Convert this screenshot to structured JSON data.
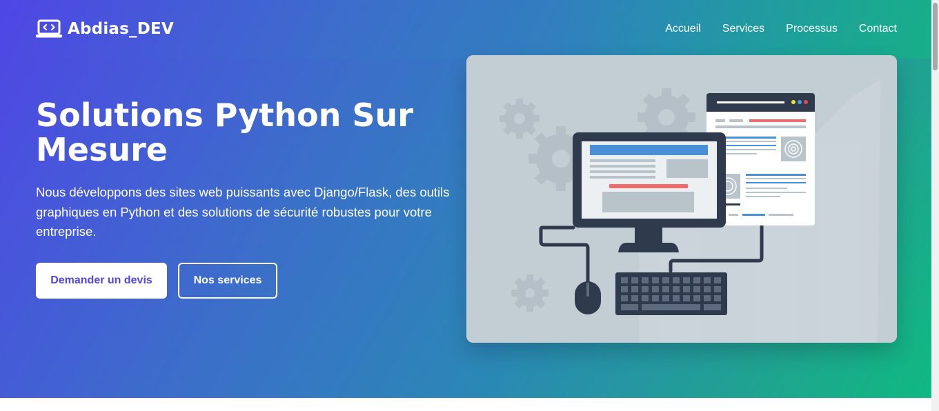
{
  "brand": {
    "name": "Abdias_DEV",
    "icon": "laptop-code-icon"
  },
  "nav": {
    "items": [
      {
        "label": "Accueil"
      },
      {
        "label": "Services"
      },
      {
        "label": "Processus"
      },
      {
        "label": "Contact"
      }
    ]
  },
  "hero": {
    "title": "Solutions Python Sur Mesure",
    "description": "Nous développons des sites web puissants avec Django/Flask, des outils graphiques en Python et des solutions de sécurité robustes pour votre entreprise.",
    "primary_button": "Demander un devis",
    "secondary_button": "Nos services"
  },
  "illustration": {
    "icon": "web-development-illustration"
  },
  "colors": {
    "gradient_start": "#4f46e5",
    "gradient_end": "#10b981",
    "primary_text": "#4f46e5",
    "white": "#ffffff"
  }
}
